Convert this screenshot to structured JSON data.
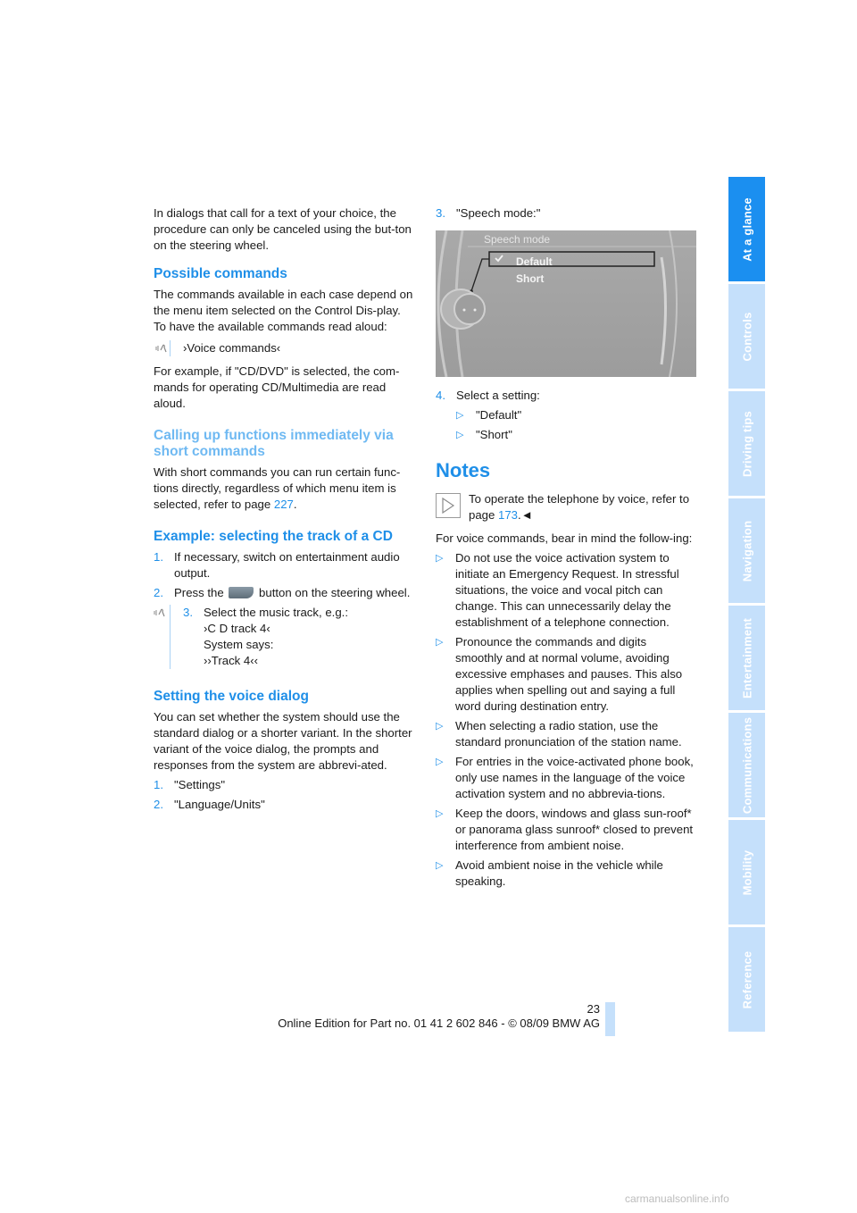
{
  "left_column": {
    "intro": "In dialogs that call for a text of your choice, the procedure can only be canceled using the but-ton on the steering wheel.",
    "possible_commands": {
      "heading": "Possible commands",
      "body": "The commands available in each case depend on the menu item selected on the Control Dis-play.",
      "instruction": "To have the available commands read aloud:",
      "voice_command": "›Voice commands‹",
      "example": "For example, if \"CD/DVD\" is selected, the com-mands for operating CD/Multimedia are read aloud."
    },
    "short_commands": {
      "heading": "Calling up functions immediately via short commands",
      "body_before_link": "With short commands you can run certain func-tions directly, regardless of which menu item is selected, refer to page ",
      "link": "227",
      "body_after_link": "."
    },
    "example_cd": {
      "heading": "Example: selecting the track of a CD",
      "steps": [
        {
          "num": "1.",
          "text": "If necessary, switch on entertainment audio output."
        },
        {
          "num": "2.",
          "text_before": "Press the ",
          "text_after": " button on the steering wheel."
        },
        {
          "num": "3.",
          "text": "Select the music track, e.g.:",
          "command": "›C D track 4‹",
          "system_says_label": "System says:",
          "system_response": "››Track 4‹‹"
        }
      ]
    },
    "voice_dialog": {
      "heading": "Setting the voice dialog",
      "body": "You can set whether the system should use the standard dialog or a shorter variant. In the shorter variant of the voice dialog, the prompts and responses from the system are abbrevi-ated.",
      "steps": [
        {
          "num": "1.",
          "text": "\"Settings\""
        },
        {
          "num": "2.",
          "text": "\"Language/Units\""
        }
      ]
    }
  },
  "right_column": {
    "step3": {
      "num": "3.",
      "text": "\"Speech mode:\""
    },
    "screen": {
      "title": "Speech mode",
      "options": [
        {
          "label": "Default",
          "selected": true
        },
        {
          "label": "Short",
          "selected": false
        }
      ]
    },
    "step4": {
      "num": "4.",
      "text": "Select a setting:",
      "options": [
        "\"Default\"",
        "\"Short\""
      ]
    },
    "notes": {
      "heading": "Notes",
      "note_before_link": "To operate the telephone by voice, refer to page ",
      "note_link": "173",
      "note_end": ".◄",
      "intro": "For voice commands, bear in mind the follow-ing:",
      "bullets": [
        "Do not use the voice activation system to initiate an Emergency Request. In stressful situations, the voice and vocal pitch can change. This can unnecessarily delay the establishment of a telephone connection.",
        "Pronounce the commands and digits smoothly and at normal volume, avoiding excessive emphases and pauses. This also applies when spelling out and saying a full word during destination entry.",
        "When selecting a radio station, use the standard pronunciation of the station name.",
        "For entries in the voice-activated phone book, only use names in the language of the voice activation system and no abbrevia-tions.",
        "Keep the doors, windows and glass sun-roof* or panorama glass sunroof* closed to prevent interference from ambient noise.",
        "Avoid ambient noise in the vehicle while speaking."
      ]
    }
  },
  "side_tabs": [
    {
      "label": "At a glance",
      "active": true
    },
    {
      "label": "Controls",
      "active": false
    },
    {
      "label": "Driving tips",
      "active": false
    },
    {
      "label": "Navigation",
      "active": false
    },
    {
      "label": "Entertainment",
      "active": false
    },
    {
      "label": "Communications",
      "active": false
    },
    {
      "label": "Mobility",
      "active": false
    },
    {
      "label": "Reference",
      "active": false
    }
  ],
  "footer": {
    "page_number": "23",
    "edition": "Online Edition for Part no. 01 41 2 602 846 - © 08/09 BMW AG"
  },
  "watermark": "carmanualsonline.info",
  "colors": {
    "accent": "#1f8fe8",
    "tab_active": "#1b8ff0",
    "tab_inactive": "#c5e0fb"
  }
}
